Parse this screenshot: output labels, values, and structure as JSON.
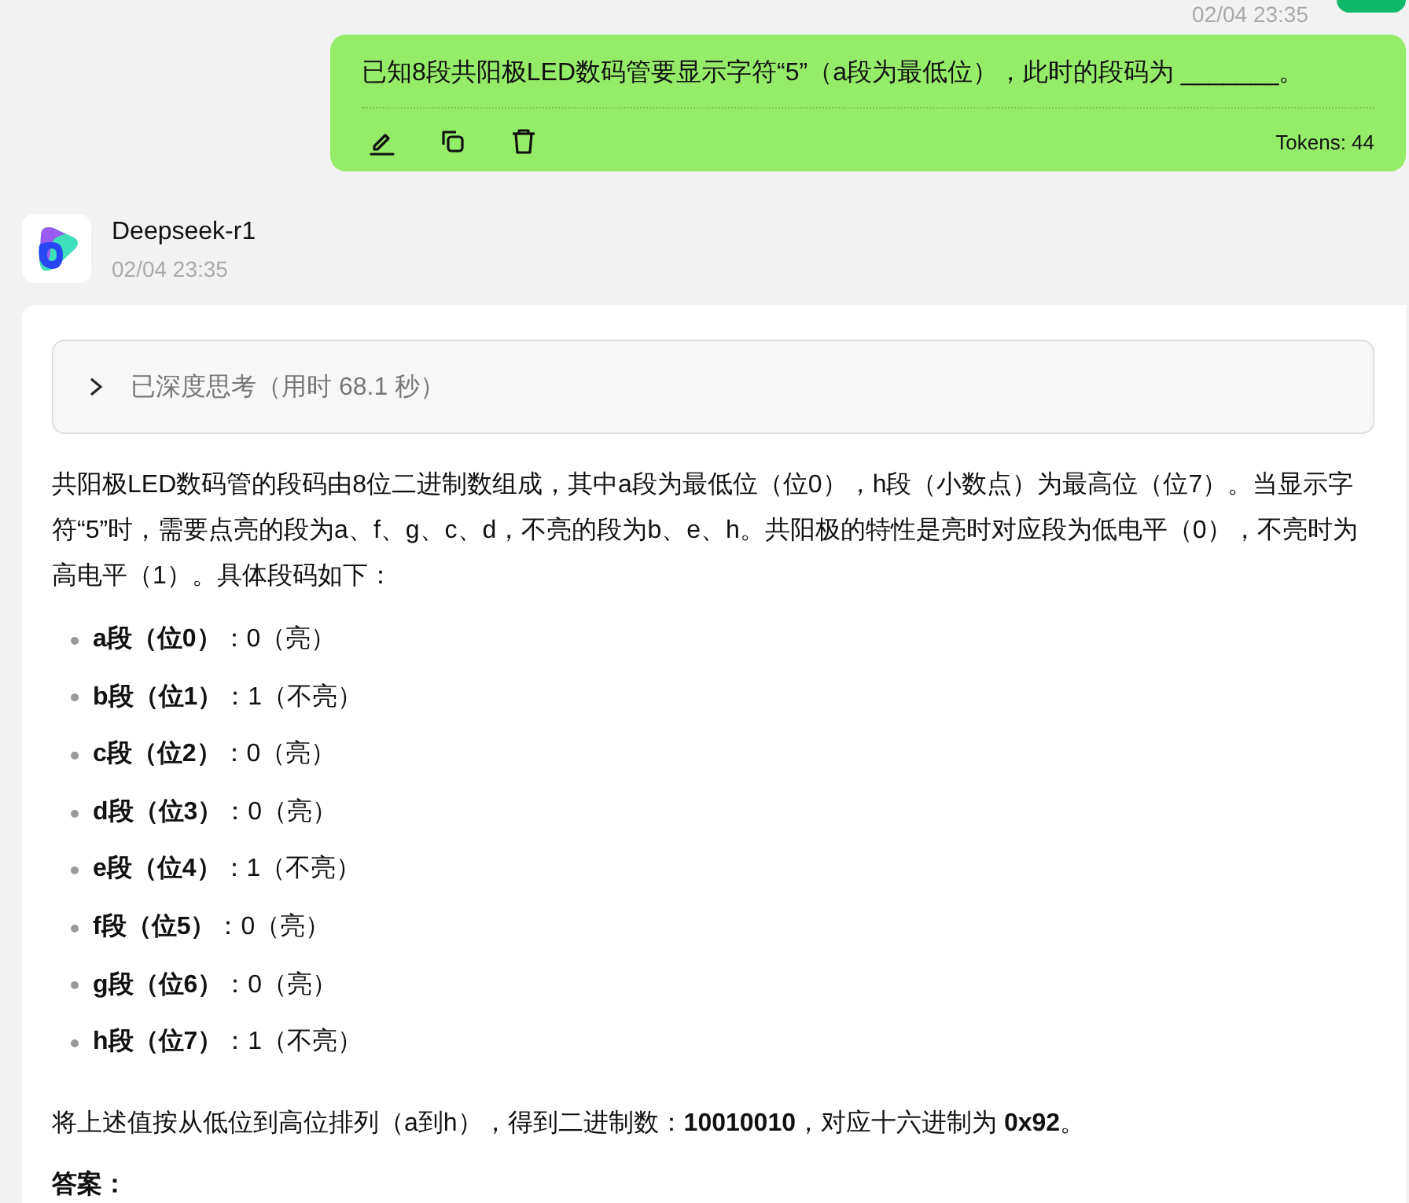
{
  "user_message": {
    "timestamp": "02/04 23:35",
    "text": "已知8段共阳极LED数码管要显示字符“5”（a段为最低位），此时的段码为 _______。",
    "tokens": "Tokens: 44"
  },
  "assistant": {
    "name": "Deepseek-r1",
    "timestamp": "02/04 23:35",
    "thinking": {
      "label": "已深度思考（用时 68.1 秒）",
      "expanded": false
    },
    "intro": "共阳极LED数码管的段码由8位二进制数组成，其中a段为最低位（位0），h段（小数点）为最高位（位7）。当显示字符“5”时，需要点亮的段为a、f、g、c、d，不亮的段为b、e、h。共阳极的特性是亮时对应段为低电平（0），不亮时为高电平（1）。具体段码如下：",
    "segments": [
      "**a段（位0）**：0（亮）",
      "**b段（位1）**：1（不亮）",
      "**c段（位2）**：0（亮）",
      "**d段（位3）**：0（亮）",
      "**e段（位4）**：1（不亮）",
      "**f段（位5）**：0（亮）",
      "**g段（位6）**：0（亮）",
      "**h段（位7）**：1（不亮）"
    ],
    "conclusion": "将上述值按从低位到高位排列（a到h），得到二进制数：**10010010**，对应十六进制为 **0x92**。",
    "answer_heading": "答案："
  }
}
